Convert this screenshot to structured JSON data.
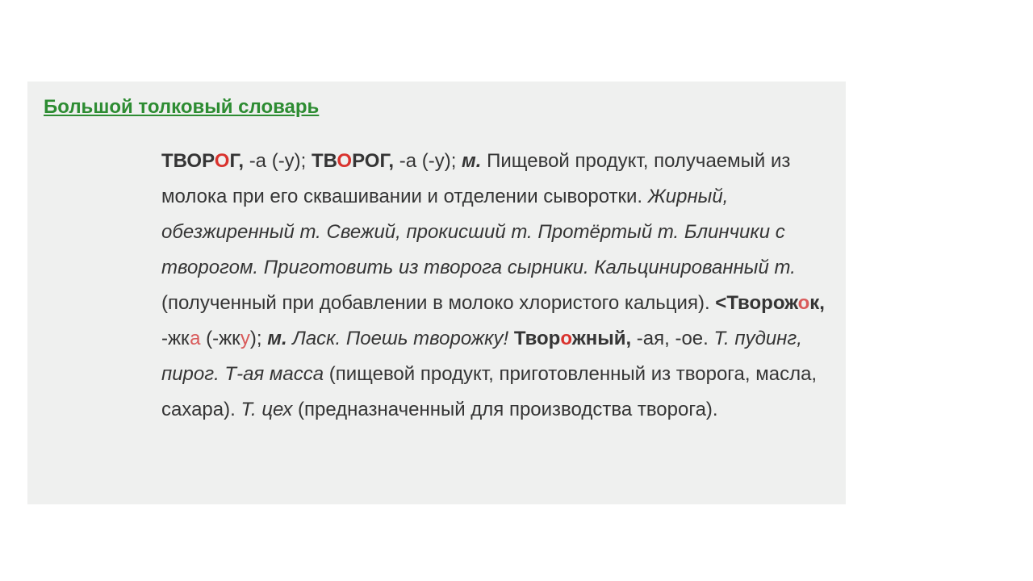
{
  "title": "Большой толковый словарь",
  "sp": " ",
  "lt": "<",
  "w1": {
    "pre": "ТВОР",
    "accent": "О",
    "post": "Г,",
    "inflect": "-а (-у);"
  },
  "w2": {
    "pre": "ТВ",
    "accent": "О",
    "post": "РОГ,",
    "inflect": "-а (-у);"
  },
  "gender1": "м.",
  "def": "Пищевой продукт, получаемый из молока при его сквашивании и отделении сыворотки.",
  "ex1": "Жирный, обезжиренный т. Свежий, прокисший т. Протёртый т. Блинчики с творогом. Приготовить из творога сырники. Кальцинированный т.",
  "note1": "(полученный при добавлении в молоко хлористого кальция).",
  "d1": {
    "pre": "Творож",
    "accent": "о",
    "post": "к,"
  },
  "d1inf": {
    "a": "-жк",
    "b": "а",
    "c": " (-жк",
    "d": "у",
    "e": ");"
  },
  "gender2": "м.",
  "ex2": "Ласк. Поешь творожку!",
  "d2": {
    "pre": "Твор",
    "accent": "о",
    "post": "жный,"
  },
  "d2inf": "-ая, -ое.",
  "ex3": "Т. пудинг, пирог. Т-ая масса",
  "note2": "(пищевой продукт, приготовленный из творога, масла, сахара).",
  "ex4": "Т. цех",
  "note3": "(предназначенный для производства творога)."
}
